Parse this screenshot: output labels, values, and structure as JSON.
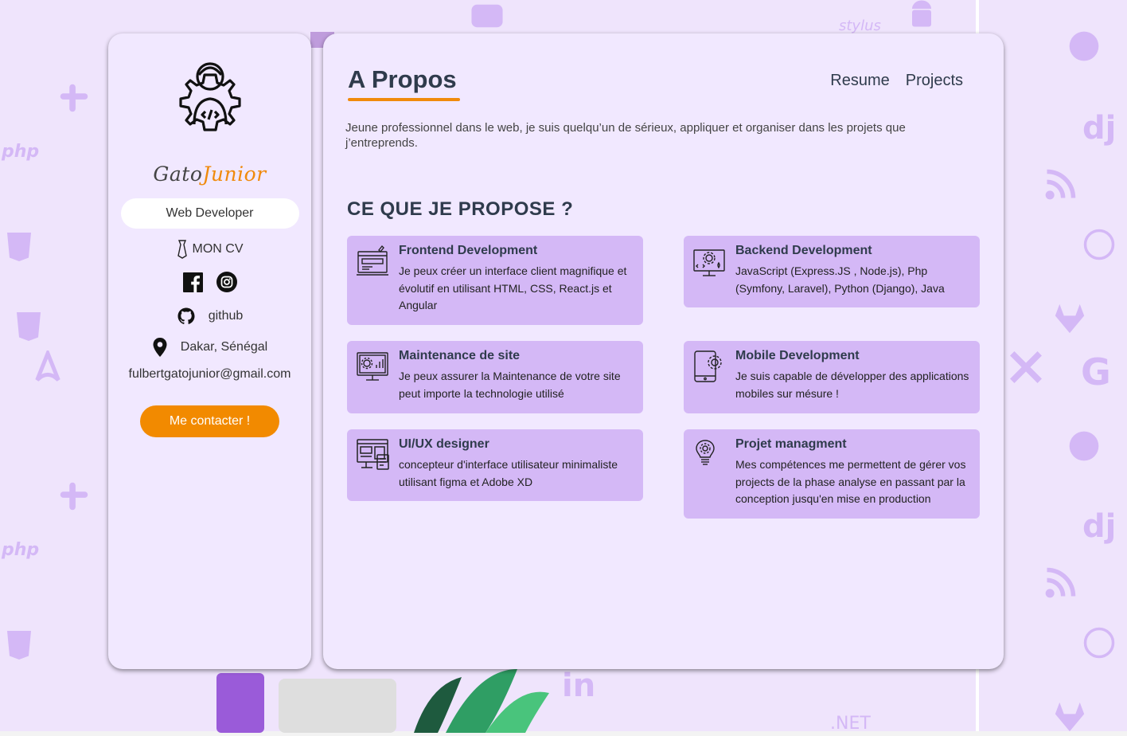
{
  "sidebar": {
    "brand_first": "Gato",
    "brand_second": "Junior",
    "role": "Web Developer",
    "cv_label": "MON CV",
    "github_label": "github",
    "location": "Dakar, Sénégal",
    "email": "fulbertgatojunior@gmail.com",
    "contact_label": "Me contacter !"
  },
  "main": {
    "title": "A Propos",
    "nav": [
      "Resume",
      "Projects"
    ],
    "intro": "Jeune professionnel dans le web, je suis quelqu’un de sérieux, appliquer et organiser dans les projets que j’entreprends.",
    "section_title": "CE QUE JE PROPOSE ?",
    "services": [
      {
        "title": "Frontend Development",
        "desc": "Je peux créer un interface client magnifique et évolutif en utilisant HTML, CSS, React.js et Angular",
        "icon": "web-design-icon"
      },
      {
        "title": "Backend Development",
        "desc": "JavaScript (Express.JS , Node.js), Php (Symfony, Laravel), Python (Django), Java",
        "icon": "backend-monitor-icon"
      },
      {
        "title": "Maintenance de site",
        "desc": "Je peux assurer la Maintenance de votre site peut importe la technologie utilisé",
        "icon": "maintenance-monitor-icon"
      },
      {
        "title": "Mobile Development",
        "desc": "Je suis capable de développer des applications mobiles sur mésure !",
        "icon": "mobile-gear-icon"
      },
      {
        "title": "UI/UX designer",
        "desc": "concepteur d'interface utilisateur minimaliste utilisant figma et Adobe XD",
        "icon": "ui-layout-icon"
      },
      {
        "title": "Projet managment",
        "desc": "Mes compétences me permettent de gérer vos projects de la phase analyse en passant par la conception jusqu'en mise en production",
        "icon": "lightbulb-gear-icon"
      }
    ]
  },
  "background": {
    "glyphs": [
      "php",
      "dj",
      "G",
      "in",
      ".NET",
      "stylus"
    ]
  },
  "colors": {
    "accent": "#f08a0c",
    "card_bg": "#f1e8ff",
    "service_bg": "#d4b8f6",
    "page_bg": "#efe4fc",
    "pattern": "#d4b8f6"
  }
}
